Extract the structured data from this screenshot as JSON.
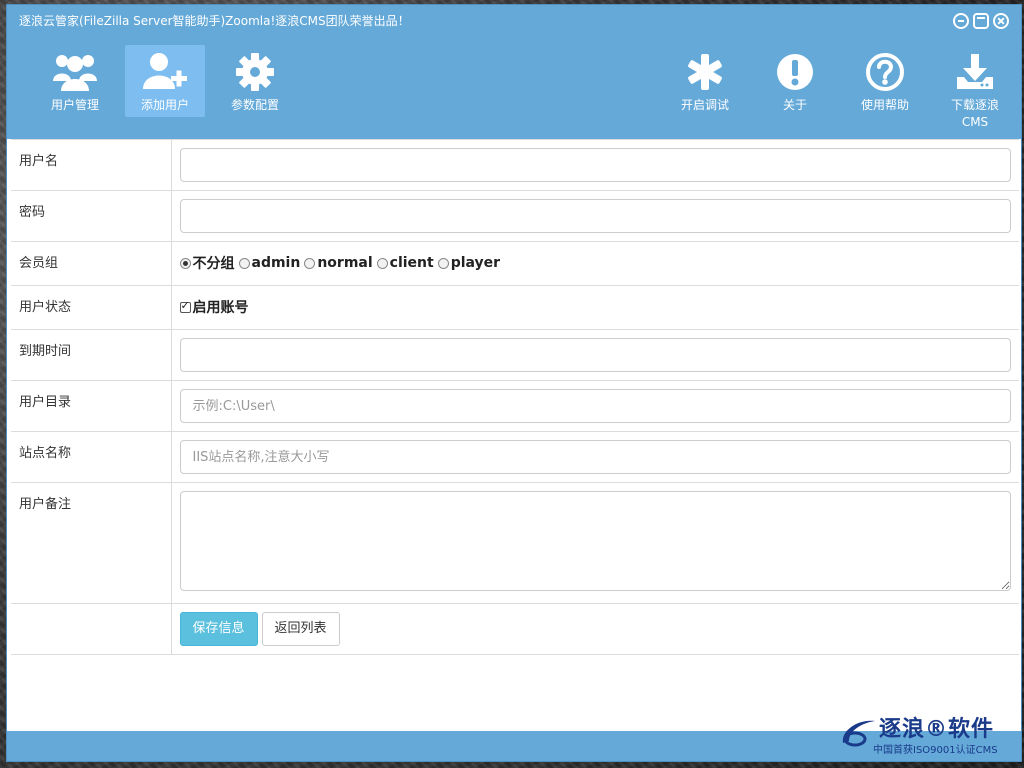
{
  "window": {
    "title": "逐浪云管家(FileZilla Server智能助手)Zoomla!逐浪CMS团队荣誉出品！"
  },
  "toolbar": {
    "left": [
      {
        "label": "用户管理",
        "icon": "users-icon"
      },
      {
        "label": "添加用户",
        "icon": "add-user-icon",
        "active": true
      },
      {
        "label": "参数配置",
        "icon": "gear-icon"
      }
    ],
    "right": [
      {
        "label": "开启调试",
        "icon": "asterisk-icon"
      },
      {
        "label": "关于",
        "icon": "exclamation-icon"
      },
      {
        "label": "使用帮助",
        "icon": "question-icon"
      },
      {
        "label": "下载逐浪",
        "label2": "CMS",
        "icon": "download-icon"
      }
    ]
  },
  "form": {
    "username": {
      "label": "用户名",
      "value": "",
      "placeholder": ""
    },
    "password": {
      "label": "密码",
      "value": "",
      "placeholder": ""
    },
    "group": {
      "label": "会员组",
      "options": [
        "不分组",
        "admin",
        "normal",
        "client",
        "player"
      ],
      "selected": "不分组"
    },
    "status": {
      "label": "用户状态",
      "checkbox_label": "启用账号",
      "checked": true
    },
    "expire": {
      "label": "到期时间",
      "value": "",
      "placeholder": ""
    },
    "directory": {
      "label": "用户目录",
      "value": "",
      "placeholder": "示例:C:\\User\\"
    },
    "site": {
      "label": "站点名称",
      "value": "",
      "placeholder": "IIS站点名称,注意大小写"
    },
    "remark": {
      "label": "用户备注",
      "value": ""
    },
    "save_label": "保存信息",
    "back_label": "返回列表"
  },
  "brand": {
    "name": "逐浪®软件",
    "subtitle": "中国首获ISO9001认证CMS"
  },
  "colors": {
    "header": "#64a9d8",
    "active_tab": "#7dbdf0",
    "primary_button": "#5bc0de"
  }
}
